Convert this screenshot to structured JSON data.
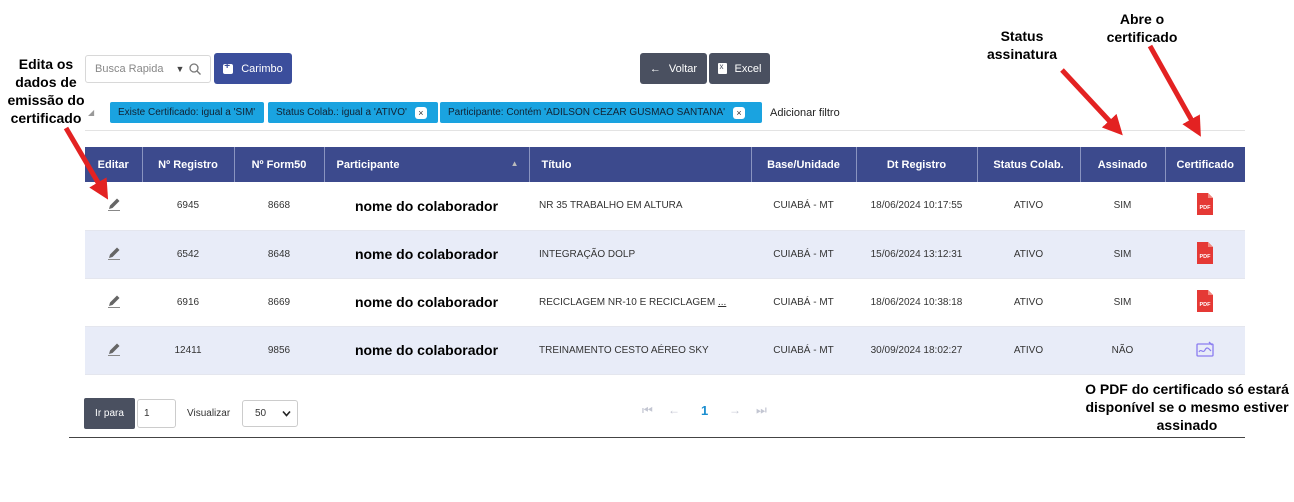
{
  "annotations": {
    "edit": "Edita os dados de emissão do certificado",
    "status": "Status assinatura",
    "cert": "Abre o certificado",
    "pdf": "O PDF do certificado só estará disponível se o mesmo estiver assinado"
  },
  "toolbar": {
    "search_placeholder": "Busca Rapida",
    "carimbo": "Carimbo",
    "voltar": "Voltar",
    "excel": "Excel"
  },
  "filters": {
    "chips": [
      "Existe Certificado: igual a 'SIM'",
      "Status Colab.: igual a 'ATIVO'",
      "Participante: Contém 'ADILSON CEZAR GUSMAO SANTANA'"
    ],
    "add": "Adicionar filtro"
  },
  "table": {
    "headers": [
      "Editar",
      "Nº Registro",
      "Nº Form50",
      "Participante",
      "Título",
      "Base/Unidade",
      "Dt Registro",
      "Status Colab.",
      "Assinado",
      "Certificado"
    ],
    "rows": [
      {
        "registro": "6945",
        "form50": "8668",
        "participante": "nome do colaborador",
        "titulo": "NR 35 TRABALHO EM ALTURA",
        "base": "CUIABÁ - MT",
        "dt": "18/06/2024 10:17:55",
        "status": "ATIVO",
        "assinado": "SIM",
        "cert": "pdf-icon"
      },
      {
        "registro": "6542",
        "form50": "8648",
        "participante": "nome do colaborador",
        "titulo": "INTEGRAÇÃO DOLP",
        "base": "CUIABÁ - MT",
        "dt": "15/06/2024 13:12:31",
        "status": "ATIVO",
        "assinado": "SIM",
        "cert": "pdf-icon"
      },
      {
        "registro": "6916",
        "form50": "8669",
        "participante": "nome do colaborador",
        "titulo": "RECICLAGEM NR-10 E RECICLAGEM",
        "titulo_more": "...",
        "base": "CUIABÁ - MT",
        "dt": "18/06/2024 10:38:18",
        "status": "ATIVO",
        "assinado": "SIM",
        "cert": "pdf-icon"
      },
      {
        "registro": "12411",
        "form50": "9856",
        "participante": "nome do colaborador",
        "titulo": "TREINAMENTO CESTO AÉREO SKY",
        "base": "CUIABÁ - MT",
        "dt": "30/09/2024 18:02:27",
        "status": "ATIVO",
        "assinado": "NÃO",
        "cert": "signature-icon"
      }
    ]
  },
  "pager": {
    "irpara": "Ir para",
    "page_value": "1",
    "visualizar": "Visualizar",
    "per_page": "50",
    "current": "1"
  },
  "colors": {
    "header": "#3c4a8d",
    "chip": "#1aa3e0",
    "pdf": "#e53935",
    "alt_row": "#e8ecf8",
    "arrow": "#e32222"
  }
}
